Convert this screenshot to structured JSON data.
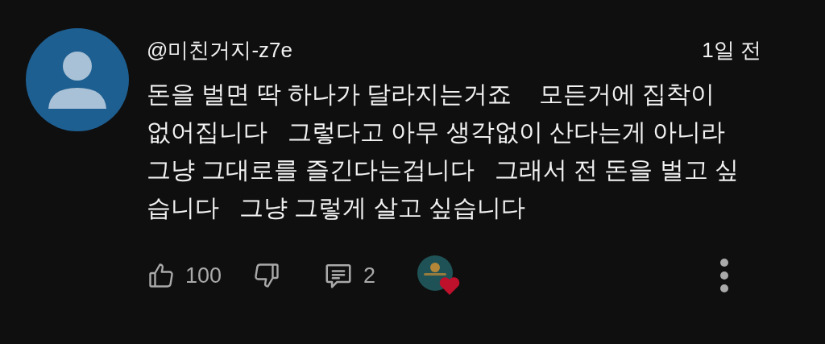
{
  "comment": {
    "author": "@미친거지-z7e",
    "time": "1일 전",
    "text_lines": [
      "돈을 벌면 딱 하나가 달라지는거죠    모든거에 집착이",
      "없어집니다   그렇다고 아무 생각없이 산다는게 아니라",
      "그냥 그대로를 즐긴다는겁니다   그래서 전 돈을 벌고 싶",
      "습니다   그냥 그렇게 살고 싶습니다"
    ],
    "likes": "100",
    "replies": "2",
    "liked": false,
    "disliked": false,
    "creator_hearted": true
  }
}
